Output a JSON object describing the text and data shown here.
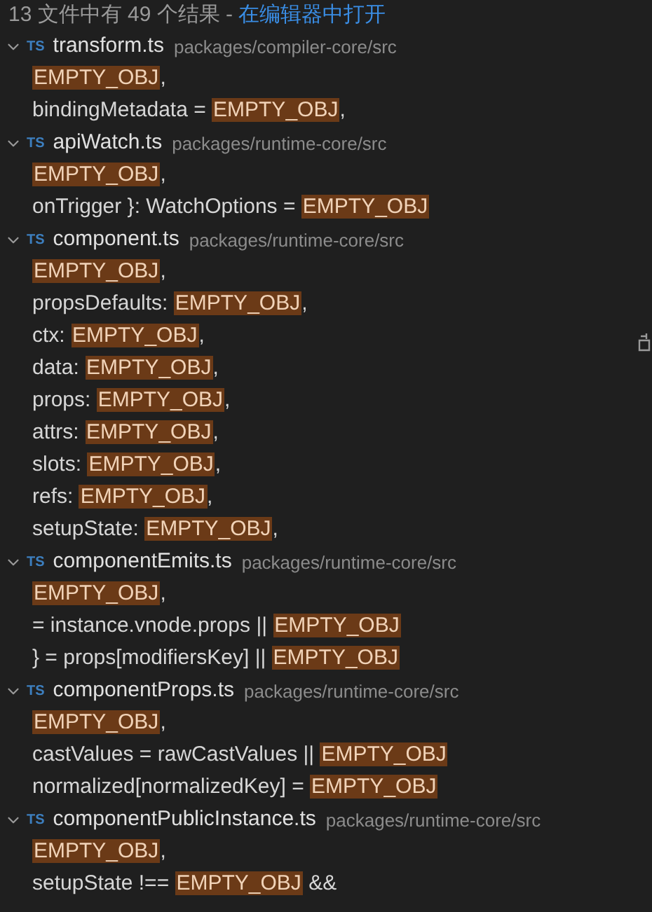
{
  "summary": {
    "text": "13 文件中有 49 个结果 -",
    "link": "在编辑器中打开"
  },
  "files": [
    {
      "badge": "TS",
      "name": "transform.ts",
      "path": "packages/compiler-core/src",
      "expanded": true,
      "matches": [
        {
          "match": "EMPTY_OBJ",
          "after": ","
        },
        {
          "before": "bindingMetadata = ",
          "match": "EMPTY_OBJ",
          "after": ","
        }
      ]
    },
    {
      "badge": "TS",
      "name": "apiWatch.ts",
      "path": "packages/runtime-core/src",
      "expanded": true,
      "matches": [
        {
          "match": "EMPTY_OBJ",
          "after": ","
        },
        {
          "before": "onTrigger }: WatchOptions = ",
          "match": "EMPTY_OBJ"
        }
      ]
    },
    {
      "badge": "TS",
      "name": "component.ts",
      "path": "packages/runtime-core/src",
      "expanded": true,
      "matches": [
        {
          "match": "EMPTY_OBJ",
          "after": ","
        },
        {
          "before": "propsDefaults: ",
          "match": "EMPTY_OBJ",
          "after": ","
        },
        {
          "before": "ctx: ",
          "match": "EMPTY_OBJ",
          "after": ","
        },
        {
          "before": "data: ",
          "match": "EMPTY_OBJ",
          "after": ","
        },
        {
          "before": "props: ",
          "match": "EMPTY_OBJ",
          "after": ","
        },
        {
          "before": "attrs: ",
          "match": "EMPTY_OBJ",
          "after": ","
        },
        {
          "before": "slots: ",
          "match": "EMPTY_OBJ",
          "after": ","
        },
        {
          "before": "refs: ",
          "match": "EMPTY_OBJ",
          "after": ","
        },
        {
          "before": "setupState: ",
          "match": "EMPTY_OBJ",
          "after": ","
        }
      ]
    },
    {
      "badge": "TS",
      "name": "componentEmits.ts",
      "path": "packages/runtime-core/src",
      "expanded": true,
      "matches": [
        {
          "match": "EMPTY_OBJ",
          "after": ","
        },
        {
          "before": "= instance.vnode.props || ",
          "match": "EMPTY_OBJ"
        },
        {
          "before": "} = props[modifiersKey] || ",
          "match": "EMPTY_OBJ"
        }
      ]
    },
    {
      "badge": "TS",
      "name": "componentProps.ts",
      "path": "packages/runtime-core/src",
      "expanded": true,
      "matches": [
        {
          "match": "EMPTY_OBJ",
          "after": ","
        },
        {
          "before": "castValues = rawCastValues || ",
          "match": "EMPTY_OBJ"
        },
        {
          "before": "normalized[normalizedKey] = ",
          "match": "EMPTY_OBJ"
        }
      ]
    },
    {
      "badge": "TS",
      "name": "componentPublicInstance.ts",
      "path": "packages/runtime-core/src",
      "expanded": true,
      "matches": [
        {
          "match": "EMPTY_OBJ",
          "after": ","
        },
        {
          "before": "setupState !== ",
          "match": "EMPTY_OBJ",
          "after": " &&"
        }
      ]
    }
  ]
}
